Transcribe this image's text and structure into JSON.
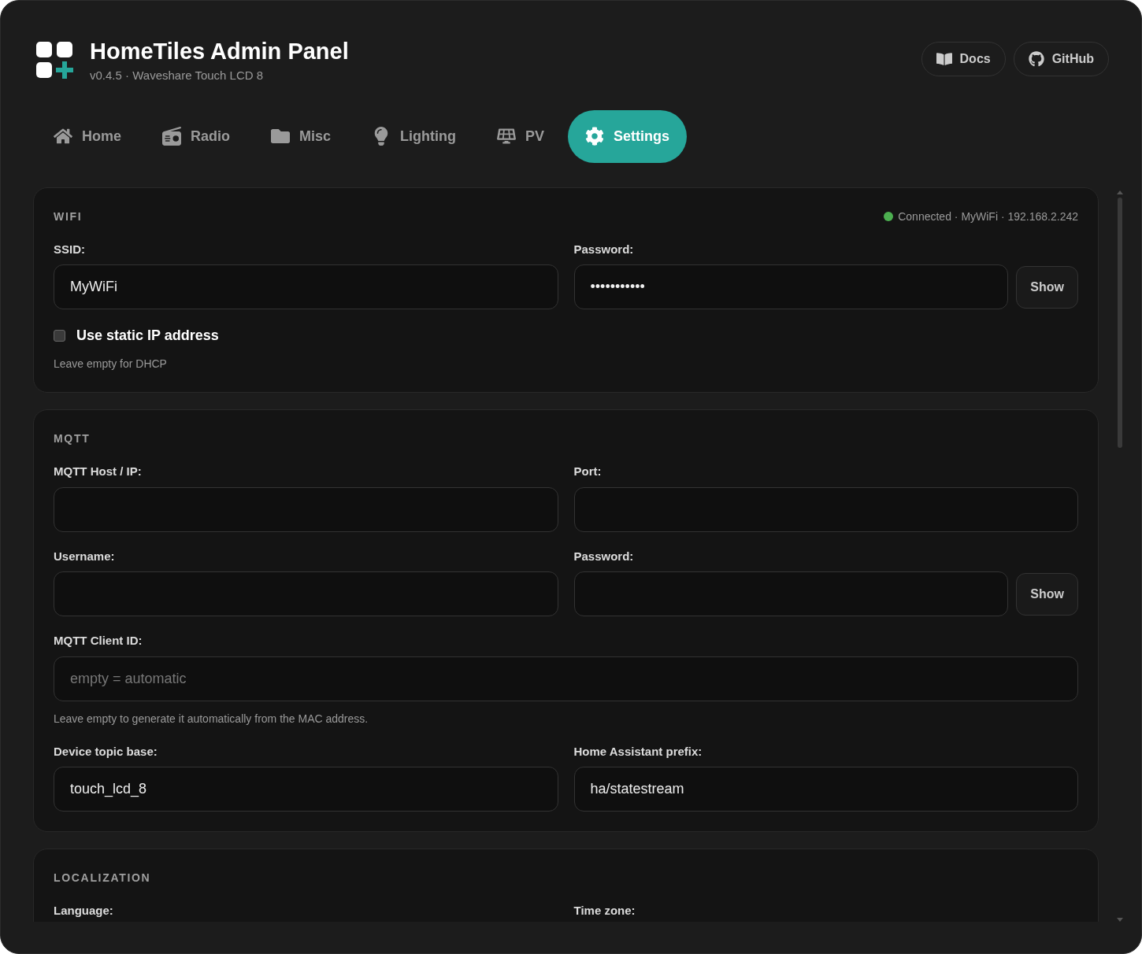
{
  "header": {
    "title": "HomeTiles Admin Panel",
    "subtitle": "v0.4.5 · Waveshare Touch LCD 8",
    "links": [
      {
        "kind": "docs",
        "label": "Docs"
      },
      {
        "kind": "github",
        "label": "GitHub"
      }
    ]
  },
  "tabs": [
    {
      "kind": "home",
      "label": "Home",
      "selected": false
    },
    {
      "kind": "radio",
      "label": "Radio",
      "selected": false
    },
    {
      "kind": "folder",
      "label": "Misc",
      "selected": false
    },
    {
      "kind": "bulb",
      "label": "Lighting",
      "selected": false
    },
    {
      "kind": "solar",
      "label": "PV",
      "selected": false
    },
    {
      "kind": "gear",
      "label": "Settings",
      "selected": true
    }
  ],
  "sections": [
    {
      "title": "WIFI",
      "status": {
        "text": "Connected · MyWiFi · 192.168.2.242",
        "color": "#4caf50"
      },
      "rows": [
        {
          "kind": "fields",
          "fields": [
            {
              "label": "SSID:",
              "value": "MyWiFi"
            },
            {
              "label": "Password:",
              "value": "•••••••••••",
              "button": "Show"
            }
          ]
        },
        {
          "kind": "checkbox",
          "label": "Use static IP address",
          "checked": false
        },
        {
          "kind": "hint",
          "text": "Leave empty for DHCP"
        }
      ]
    },
    {
      "title": "MQTT",
      "rows": [
        {
          "kind": "fields",
          "fields": [
            {
              "label": "MQTT Host / IP:"
            },
            {
              "label": "Port:"
            }
          ]
        },
        {
          "kind": "fields",
          "fields": [
            {
              "label": "Username:"
            },
            {
              "label": "Password:",
              "button": "Show"
            }
          ]
        },
        {
          "kind": "fields",
          "fields": [
            {
              "label": "MQTT Client ID:",
              "placeholder": "empty = automatic"
            }
          ]
        },
        {
          "kind": "hint",
          "text": "Leave empty to generate it automatically from the MAC address."
        },
        {
          "kind": "fields",
          "fields": [
            {
              "label": "Device topic base:",
              "value": "touch_lcd_8"
            },
            {
              "label": "Home Assistant prefix:",
              "value": "ha/statestream"
            }
          ]
        }
      ]
    },
    {
      "title": "LOCALIZATION",
      "rows": [
        {
          "kind": "fields",
          "fields": [
            {
              "label": "Language:"
            },
            {
              "label": "Time zone:"
            }
          ]
        }
      ]
    }
  ]
}
